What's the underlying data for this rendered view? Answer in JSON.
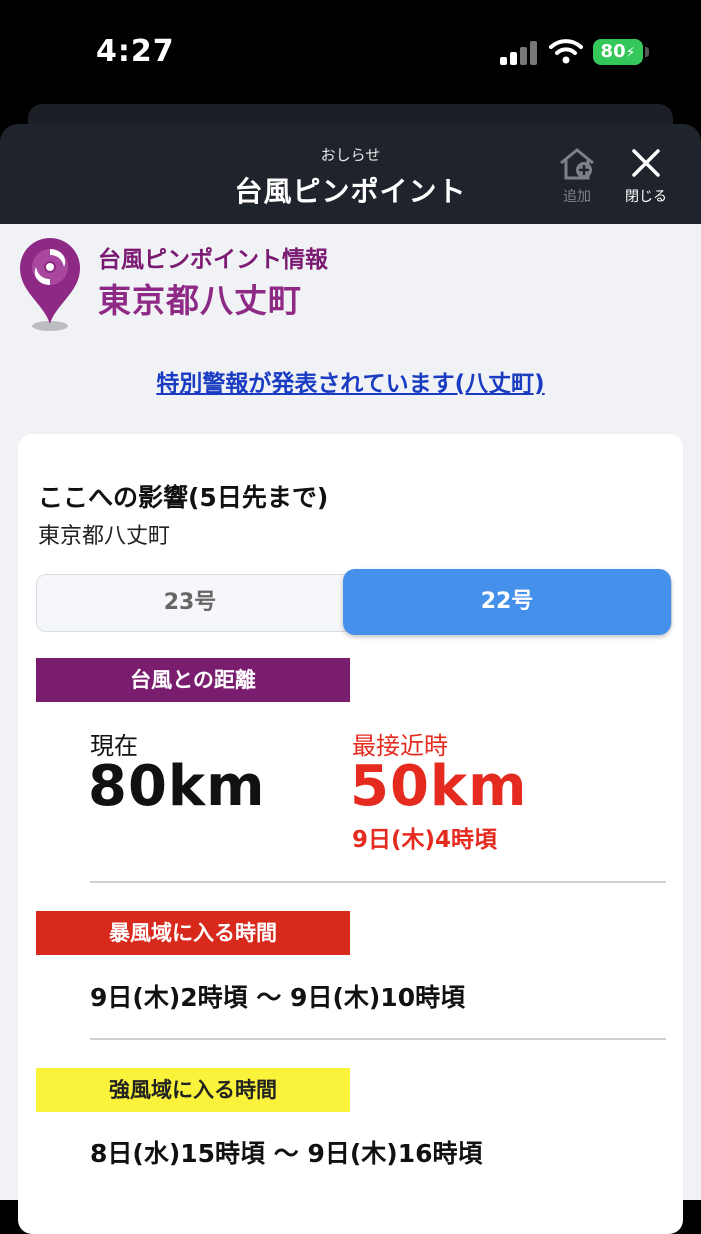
{
  "status_bar": {
    "time": "4:27",
    "battery": "80"
  },
  "header": {
    "subtitle": "おしらせ",
    "title": "台風ピンポイント",
    "add_label": "追加",
    "close_label": "閉じる"
  },
  "pin": {
    "subtitle": "台風ピンポイント情報",
    "location": "東京都八丈町"
  },
  "alert_link": "特別警報が発表されています(八丈町)",
  "card": {
    "title": "ここへの影響(5日先まで)",
    "location": "東京都八丈町",
    "tabs": [
      {
        "label": "23号",
        "selected": false
      },
      {
        "label": "22号",
        "selected": true
      }
    ],
    "distance": {
      "label": "台風との距離",
      "current_label": "現在",
      "current_value": "80km",
      "closest_label": "最接近時",
      "closest_value": "50km",
      "closest_time": "9日(木)4時頃"
    },
    "storm_zone": {
      "label": "暴風域に入る時間",
      "range": "9日(木)2時頃 〜 9日(木)10時頃"
    },
    "strong_wind_zone": {
      "label": "強風域に入る時間",
      "range": "8日(水)15時頃 〜 9日(木)16時頃"
    }
  },
  "colors": {
    "accent_purple": "#7a1d6f",
    "storm_red": "#d7291c",
    "strong_yellow": "#faf23b",
    "tab_active": "#4490ea",
    "alert_text": "#e52b20",
    "link_blue": "#1a3cc2",
    "battery_green": "#34c759"
  },
  "icons": [
    "cellular-signal-icon",
    "wifi-icon",
    "battery-icon",
    "home-add-icon",
    "close-icon",
    "typhoon-pin-icon"
  ]
}
